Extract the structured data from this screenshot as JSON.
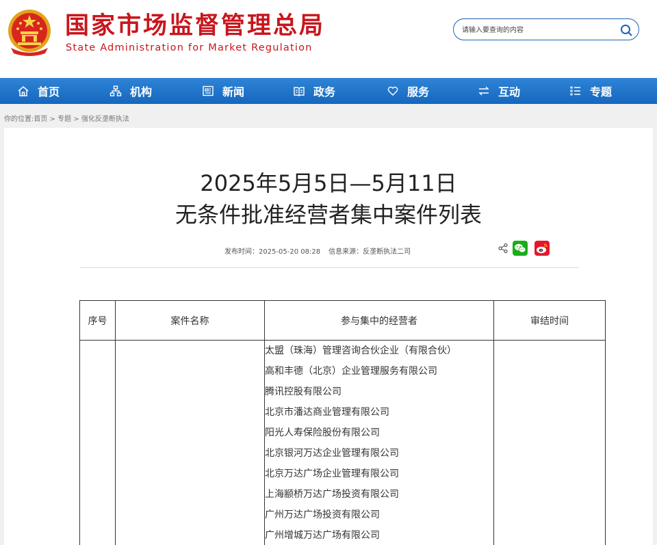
{
  "header": {
    "title": "国家市场监督管理总局",
    "subtitle": "State Administration for Market Regulation"
  },
  "search": {
    "placeholder": "请输入要查询的内容"
  },
  "nav": {
    "items": [
      {
        "label": "首页",
        "icon": "home-icon"
      },
      {
        "label": "机构",
        "icon": "org-icon"
      },
      {
        "label": "新闻",
        "icon": "news-icon"
      },
      {
        "label": "政务",
        "icon": "gov-icon"
      },
      {
        "label": "服务",
        "icon": "heart-icon"
      },
      {
        "label": "互动",
        "icon": "exchange-icon"
      },
      {
        "label": "专题",
        "icon": "topic-icon"
      }
    ]
  },
  "breadcrumb": {
    "prefix": "你的位置:",
    "items": [
      "首页",
      "专题",
      "强化反垄断执法"
    ],
    "separator": " > "
  },
  "article": {
    "title_line1": "2025年5月5日—5月11日",
    "title_line2": "无条件批准经营者集中案件列表",
    "publish_label": "发布时间：",
    "publish_time": "2025-05-20 08:28",
    "source_label": "信息来源：",
    "source": "反垄断执法二司"
  },
  "table": {
    "headers": [
      "序号",
      "案件名称",
      "参与集中的经营者",
      "审结时间"
    ],
    "rows": [
      {
        "index": "",
        "name": "",
        "parties": [
          "太盟（珠海）管理咨询合伙企业（有限合伙）",
          "高和丰德（北京）企业管理服务有限公司",
          "腾讯控股有限公司",
          "北京市潘达商业管理有限公司",
          "阳光人寿保险股份有限公司",
          "北京银河万达企业管理有限公司",
          "北京万达广场企业管理有限公司",
          "上海颛桥万达广场投资有限公司",
          "广州万达广场投资有限公司",
          "广州增城万达广场有限公司"
        ],
        "date": ""
      }
    ]
  },
  "colors": {
    "brand_red": "#c8161d",
    "nav_blue": "#1567be",
    "wechat_green": "#1aad19",
    "weibo_red": "#e6162d"
  }
}
